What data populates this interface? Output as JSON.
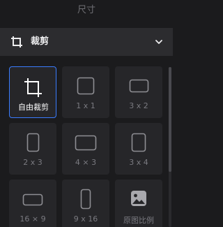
{
  "header": {
    "title": "尺寸"
  },
  "crop_dropdown": {
    "label": "裁剪",
    "icon": "crop-icon",
    "chevron": "chevron-down-icon"
  },
  "accent_color": "#3a7cff",
  "ratios": [
    {
      "label": "自由裁剪",
      "icon": "crop-icon",
      "selected": true
    },
    {
      "label": "1 x 1",
      "icon": "square-1x1-icon",
      "selected": false
    },
    {
      "label": "3 x 2",
      "icon": "rect-3x2-icon",
      "selected": false
    },
    {
      "label": "2 x 3",
      "icon": "rect-2x3-icon",
      "selected": false
    },
    {
      "label": "4 × 3",
      "icon": "rect-4x3-icon",
      "selected": false
    },
    {
      "label": "3 x 4",
      "icon": "rect-3x4-icon",
      "selected": false
    },
    {
      "label": "16 × 9",
      "icon": "rect-16x9-icon",
      "selected": false
    },
    {
      "label": "9 x 16",
      "icon": "rect-9x16-icon",
      "selected": false
    },
    {
      "label": "原图比例",
      "icon": "image-icon",
      "selected": false
    }
  ]
}
